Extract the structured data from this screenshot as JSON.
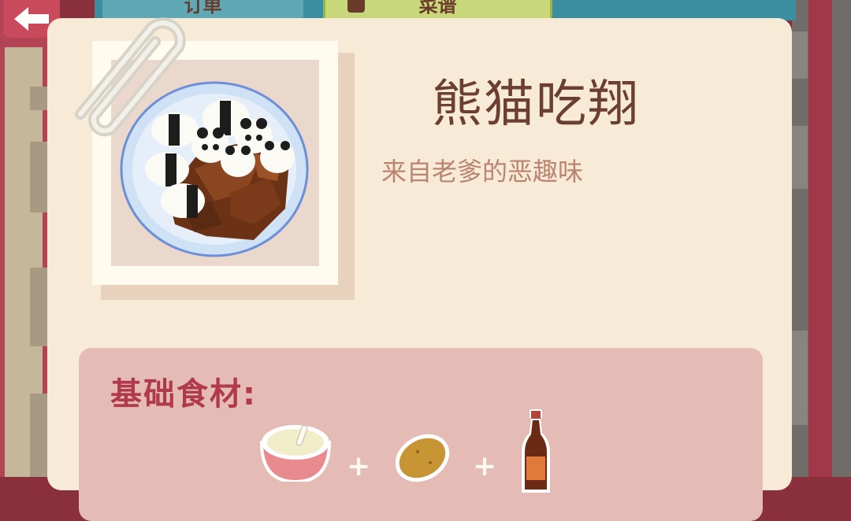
{
  "nav": {
    "back_icon": "arrow-left-icon",
    "tab_order_label": "订单",
    "tab_recipe_label": "菜谱",
    "tab_recipe_icon": "chef-hat-icon"
  },
  "dish": {
    "name": "熊猫吃翔",
    "description": "来自老爹的恶趣味",
    "image_icon": "panda-rice-dish-icon"
  },
  "ingredients": {
    "title": "基础食材:",
    "items": [
      {
        "icon": "porridge-bowl-icon"
      },
      {
        "icon": "potato-icon"
      },
      {
        "icon": "soy-sauce-bottle-icon"
      }
    ],
    "separator": "+"
  },
  "colors": {
    "card_bg": "#f7ead6",
    "title": "#6b4032",
    "description": "#b98571",
    "ingredient_title": "#b03a4c",
    "panel_bg": "#e5bcb5"
  }
}
